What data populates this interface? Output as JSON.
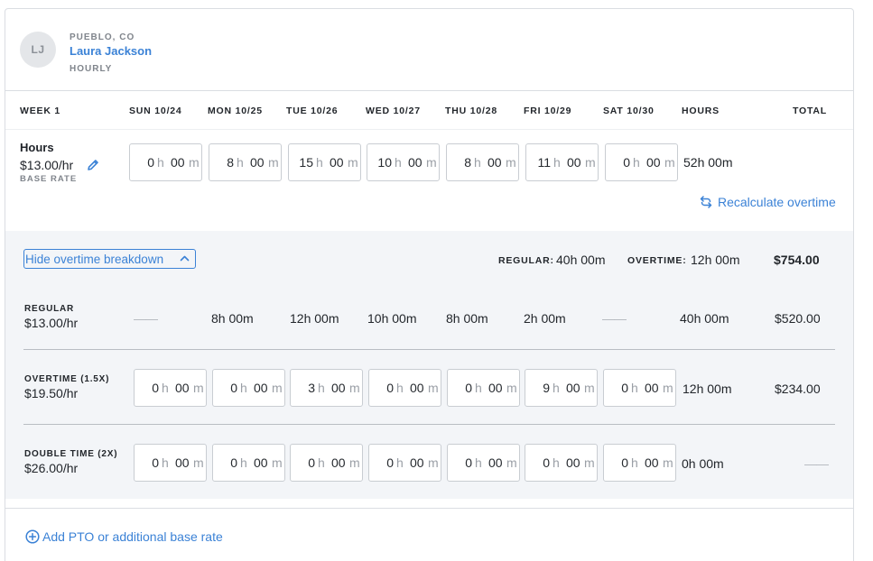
{
  "employee": {
    "initials": "LJ",
    "location": "PUEBLO, CO",
    "name": "Laura Jackson",
    "pay_type": "HOURLY"
  },
  "week": {
    "label": "WEEK 1",
    "days": [
      "SUN 10/24",
      "MON 10/25",
      "TUE 10/26",
      "WED 10/27",
      "THU 10/28",
      "FRI 10/29",
      "SAT 10/30"
    ],
    "hours_header": "HOURS",
    "total_header": "TOTAL"
  },
  "hours_row": {
    "title": "Hours",
    "rate": "$13.00/hr",
    "rate_label": "BASE RATE",
    "entries": [
      {
        "h": "0",
        "m": "00"
      },
      {
        "h": "8",
        "m": "00"
      },
      {
        "h": "15",
        "m": "00"
      },
      {
        "h": "10",
        "m": "00"
      },
      {
        "h": "8",
        "m": "00"
      },
      {
        "h": "11",
        "m": "00"
      },
      {
        "h": "0",
        "m": "00"
      }
    ],
    "total_hours": "52h 00m",
    "unit_h": "h",
    "unit_m": "m"
  },
  "recalculate_label": "Recalculate overtime",
  "breakdown": {
    "toggle_label": "Hide overtime breakdown",
    "summary": {
      "regular_label": "REGULAR:",
      "regular_value": "40h 00m",
      "overtime_label": "OVERTIME:",
      "overtime_value": "12h 00m",
      "total": "$754.00"
    },
    "regular": {
      "label": "REGULAR",
      "rate": "$13.00/hr",
      "days": [
        "——",
        "8h 00m",
        "12h 00m",
        "10h 00m",
        "8h 00m",
        "2h 00m",
        "——"
      ],
      "total_hours": "40h 00m",
      "total": "$520.00"
    },
    "overtime": {
      "label": "OVERTIME (1.5X)",
      "rate": "$19.50/hr",
      "entries": [
        {
          "h": "0",
          "m": "00"
        },
        {
          "h": "0",
          "m": "00"
        },
        {
          "h": "3",
          "m": "00"
        },
        {
          "h": "0",
          "m": "00"
        },
        {
          "h": "0",
          "m": "00"
        },
        {
          "h": "9",
          "m": "00"
        },
        {
          "h": "0",
          "m": "00"
        }
      ],
      "total_hours": "12h 00m",
      "total": "$234.00"
    },
    "double_time": {
      "label": "DOUBLE TIME (2X)",
      "rate": "$26.00/hr",
      "entries": [
        {
          "h": "0",
          "m": "00"
        },
        {
          "h": "0",
          "m": "00"
        },
        {
          "h": "0",
          "m": "00"
        },
        {
          "h": "0",
          "m": "00"
        },
        {
          "h": "0",
          "m": "00"
        },
        {
          "h": "0",
          "m": "00"
        },
        {
          "h": "0",
          "m": "00"
        }
      ],
      "total_hours": "0h 00m",
      "total": "——"
    }
  },
  "add_pto_label": "Add PTO or additional base rate",
  "colors": {
    "accent": "#3b82d6",
    "band": "#f3f5f8",
    "border": "#dadde2"
  }
}
